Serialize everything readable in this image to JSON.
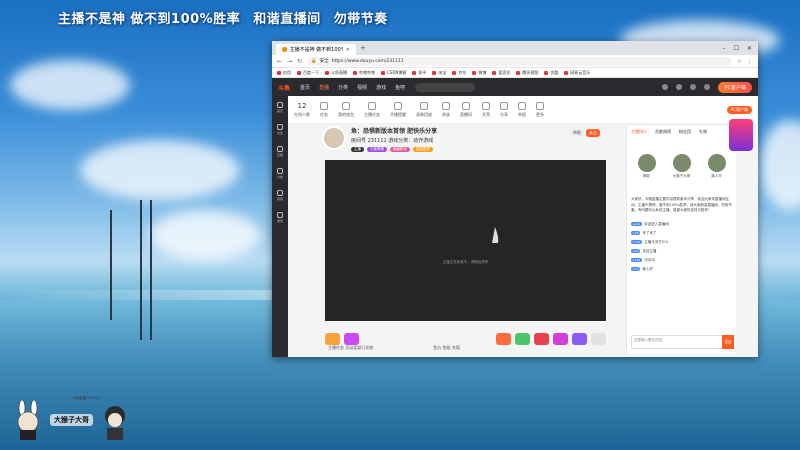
{
  "overlay": {
    "line1": "主播不是神 做不到100%胜率",
    "line2": "和谐直播间",
    "line3": "勿带节奏"
  },
  "browser": {
    "tab_title": "主播不是神 做不到100%胜率 和谐直播间 勿带节奏",
    "url": "https://www.douyu.com/231111",
    "url_prefix": "安全"
  },
  "bookmarks": [
    "应用",
    "百度一下",
    "斗鱼直播",
    "哔哩哔哩",
    "CSDN博客",
    "知乎",
    "淘宝",
    "京东",
    "微博",
    "爱奇艺",
    "腾讯视频",
    "优酷",
    "网易云音乐"
  ],
  "site": {
    "logo": "斗鱼",
    "nav": [
      "首页",
      "直播",
      "分类",
      "视频",
      "游戏",
      "鱼吧"
    ],
    "active_nav": "直播",
    "promo": "PC客户端"
  },
  "left_rail": [
    "首页",
    "关注",
    "直播",
    "分类",
    "视频",
    "游戏"
  ],
  "gift_bar": {
    "count": "12",
    "count_label": "在线人数",
    "items": [
      "任务",
      "我的钱包",
      "主播任务",
      "开播提醒",
      "录像回放",
      "贵族",
      "直播间",
      "开黑",
      "分享",
      "举报",
      "更多"
    ],
    "pc_btn": "PC客户端"
  },
  "room": {
    "title": "鱼：恐惧新版本首领 肥快乐分享",
    "meta": "房间号 231111  游戏分类：动作游戏",
    "tags": [
      "主播",
      "王者荣耀",
      "超级粉丝",
      "连续签到"
    ],
    "follow": "关注",
    "report": "举报"
  },
  "video": {
    "message": "主播正在休息中，请稍后再来"
  },
  "bottom": {
    "left_label": "主播任务  活动奖励已发放",
    "right_label": "鱼丸  鱼翅  充值"
  },
  "chat": {
    "tabs": [
      "主播排行",
      "贡献周榜",
      "粉丝团",
      "礼物"
    ],
    "active_tab": "主播排行",
    "fans": [
      "萌新",
      "大猴子大哥",
      "路人甲"
    ],
    "notice": "大家好，今晚直播主要内容是新版本分享，欢迎大家来直播间互动。主播不是神，做不到100%胜率，请大家和谐直播间，勿带节奏。有问题可以私信主播，感谢大家的支持与陪伴！",
    "lines": [
      {
        "level": "Lv12",
        "text": "欢迎进入直播间"
      },
      {
        "level": "Lv8",
        "text": "来了来了"
      },
      {
        "level": "Lv15",
        "text": "主播今天打什么"
      },
      {
        "level": "Lv6",
        "text": "支持主播"
      },
      {
        "level": "Lv20",
        "text": "冲冲冲"
      },
      {
        "level": "Lv3",
        "text": "晚上好"
      }
    ],
    "input_placeholder": "这里输入聊天内容",
    "send": "发送"
  },
  "watermark": {
    "name": "大猴子大哥",
    "sub": "斗鱼直播 231111"
  },
  "colors": {
    "accent": "#ff5d23",
    "header_bg": "#2b2b2f",
    "video_bg": "#262626"
  }
}
